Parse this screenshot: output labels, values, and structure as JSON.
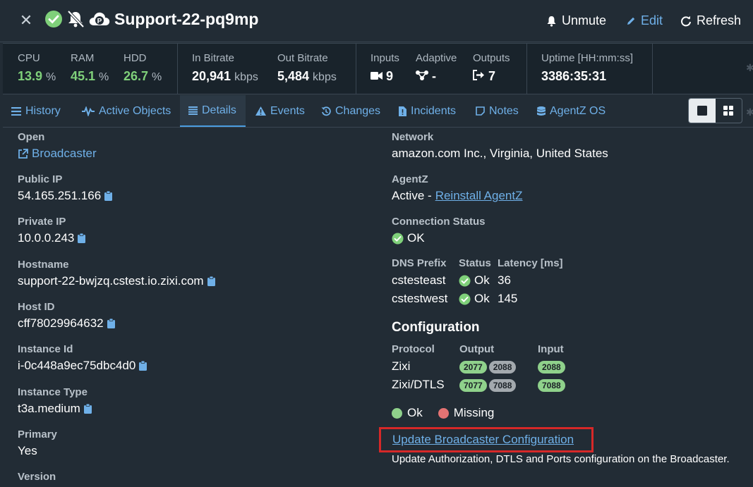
{
  "header": {
    "title": "Support-22-pq9mp",
    "unmute_label": "Unmute",
    "edit_label": "Edit",
    "refresh_label": "Refresh"
  },
  "stats": {
    "cpu": {
      "label": "CPU",
      "value": "13.9",
      "unit": "%"
    },
    "ram": {
      "label": "RAM",
      "value": "45.1",
      "unit": "%"
    },
    "hdd": {
      "label": "HDD",
      "value": "26.7",
      "unit": "%"
    },
    "in_bitrate": {
      "label": "In Bitrate",
      "value": "20,941",
      "unit": "kbps"
    },
    "out_bitrate": {
      "label": "Out Bitrate",
      "value": "5,484",
      "unit": "kbps"
    },
    "inputs": {
      "label": "Inputs",
      "value": "9"
    },
    "adaptive": {
      "label": "Adaptive",
      "value": "-"
    },
    "outputs": {
      "label": "Outputs",
      "value": "7"
    },
    "uptime": {
      "label": "Uptime [HH:mm:ss]",
      "value": "3386:35:31"
    }
  },
  "tabs": [
    {
      "label": "History"
    },
    {
      "label": "Active Objects"
    },
    {
      "label": "Details"
    },
    {
      "label": "Events"
    },
    {
      "label": "Changes"
    },
    {
      "label": "Incidents"
    },
    {
      "label": "Notes"
    },
    {
      "label": "AgentZ OS"
    }
  ],
  "details": {
    "open": {
      "label": "Open",
      "link": "Broadcaster"
    },
    "public_ip": {
      "label": "Public IP",
      "value": "54.165.251.166"
    },
    "private_ip": {
      "label": "Private IP",
      "value": "10.0.0.243"
    },
    "hostname": {
      "label": "Hostname",
      "value": "support-22-bwjzq.cstest.io.zixi.com"
    },
    "host_id": {
      "label": "Host ID",
      "value": "cff78029964632"
    },
    "instance_id": {
      "label": "Instance Id",
      "value": "i-0c448a9ec75dbc4d0"
    },
    "instance_type": {
      "label": "Instance Type",
      "value": "t3a.medium"
    },
    "primary": {
      "label": "Primary",
      "value": "Yes"
    },
    "version": {
      "label": "Version"
    }
  },
  "right": {
    "network": {
      "label": "Network",
      "value": "amazon.com Inc., Virginia, United States"
    },
    "agentz": {
      "label": "AgentZ",
      "status": "Active -",
      "link": "Reinstall AgentZ"
    },
    "connection": {
      "label": "Connection Status",
      "value": "OK"
    },
    "dns": {
      "headers": [
        "DNS Prefix",
        "Status",
        "Latency [ms]"
      ],
      "rows": [
        {
          "prefix": "cstesteast",
          "status": "Ok",
          "latency": "36"
        },
        {
          "prefix": "cstestwest",
          "status": "Ok",
          "latency": "145"
        }
      ]
    },
    "configuration": {
      "title": "Configuration",
      "headers": [
        "Protocol",
        "Output",
        "Input"
      ],
      "rows": [
        {
          "protocol": "Zixi",
          "out_ok": "2077",
          "out_other": "2088",
          "input": "2088"
        },
        {
          "protocol": "Zixi/DTLS",
          "out_ok": "7077",
          "out_other": "7088",
          "input": "7088"
        }
      ]
    },
    "legend": {
      "ok": "Ok",
      "missing": "Missing"
    },
    "update_link": "Update Broadcaster Configuration",
    "update_desc": "Update Authorization, DTLS and Ports configuration on the Broadcaster."
  },
  "colors": {
    "accent": "#6fb0e8",
    "ok": "#7fd07a",
    "missing": "#e57373",
    "highlight": "#d62828"
  }
}
